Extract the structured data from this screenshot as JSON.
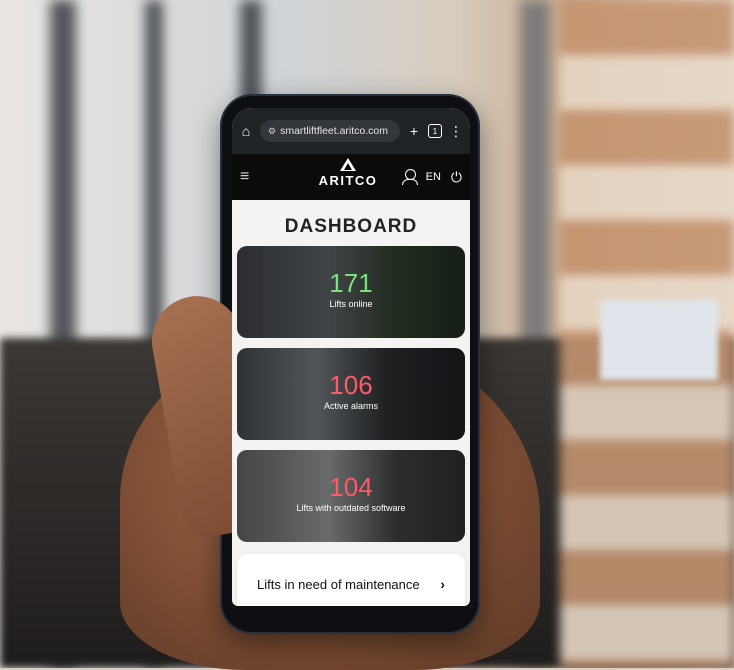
{
  "browser": {
    "url": "smartliftfleet.aritco.com",
    "tab_count": "1"
  },
  "app": {
    "logo_text": "ARITCO",
    "language": "EN"
  },
  "dashboard": {
    "title": "DASHBOARD",
    "cards": [
      {
        "value": "171",
        "label": "Lifts online",
        "color": "#7be07f"
      },
      {
        "value": "106",
        "label": "Active alarms",
        "color": "#ff5b66"
      },
      {
        "value": "104",
        "label": "Lifts with outdated software",
        "color": "#ff5b66"
      }
    ],
    "maintenance_label": "Lifts in need of maintenance"
  },
  "icons": [
    "home-icon",
    "tune-icon",
    "plus-icon",
    "tabs-icon",
    "more-icon",
    "menu-icon",
    "user-icon",
    "power-icon",
    "chevron-right-icon"
  ]
}
